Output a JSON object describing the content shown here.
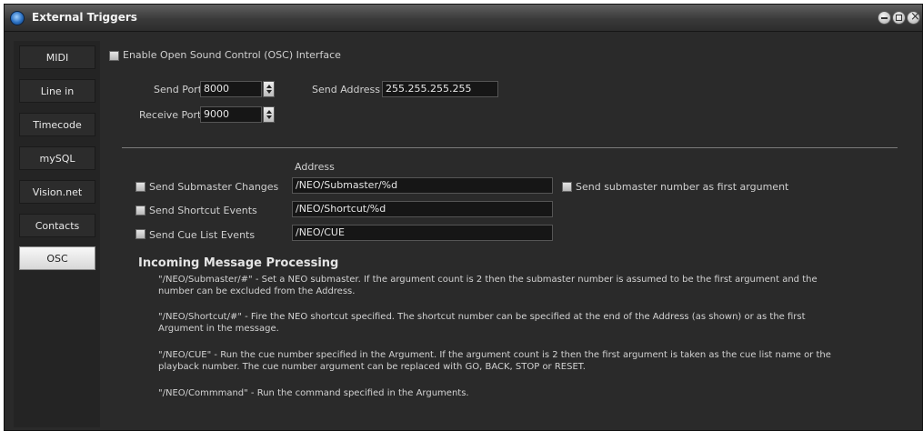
{
  "window": {
    "title": "External Triggers"
  },
  "sidebar": {
    "tabs": [
      {
        "label": "MIDI"
      },
      {
        "label": "Line in"
      },
      {
        "label": "Timecode"
      },
      {
        "label": "mySQL"
      },
      {
        "label": "Vision.net"
      },
      {
        "label": "Contacts"
      },
      {
        "label": "OSC",
        "active": true
      }
    ]
  },
  "osc": {
    "enable_label": "Enable Open Sound Control (OSC) Interface",
    "send_port_label": "Send Port",
    "send_port_value": "8000",
    "send_address_label": "Send Address",
    "send_address_value": "255.255.255.255",
    "receive_port_label": "Receive Port",
    "receive_port_value": "9000",
    "address_header": "Address",
    "rows": [
      {
        "label": "Send Submaster Changes",
        "address": "/NEO/Submaster/%d"
      },
      {
        "label": "Send Shortcut Events",
        "address": "/NEO/Shortcut/%d"
      },
      {
        "label": "Send Cue List Events",
        "address": "/NEO/CUE"
      }
    ],
    "submaster_arg_label": "Send submaster number as first argument"
  },
  "incoming": {
    "heading": "Incoming Message Processing",
    "paragraphs": [
      "\"/NEO/Submaster/#\" - Set a NEO submaster. If the argument count is 2 then the submaster number is assumed to be the first argument and the number can be excluded from the Address.",
      "\"/NEO/Shortcut/#\" - Fire the NEO shortcut specified. The shortcut number can be specified at the end of the Address (as shown) or as the first Argument in the message.",
      "\"/NEO/CUE\" - Run the cue number specified in the Argument. If the argument count is 2 then the first argument is taken as the cue list name or the playback number. The cue number argument can be replaced with GO, BACK, STOP or RESET.",
      "\"/NEO/Commmand\" - Run the command specified in the Arguments."
    ]
  }
}
